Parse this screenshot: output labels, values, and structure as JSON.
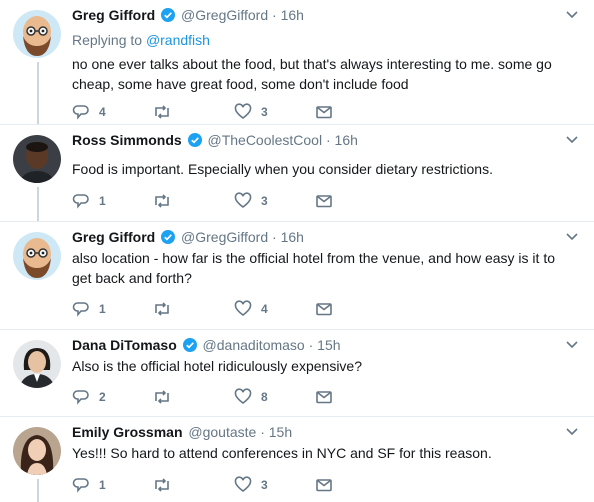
{
  "tweets": [
    {
      "name": "Greg Gifford",
      "handle": "@GregGifford",
      "time": "16h",
      "verified": true,
      "replying_prefix": "Replying to",
      "replying_to": "@randfish",
      "text": "no one ever talks about the food, but that's always interesting to me. some go cheap, some have great food, some don't include food",
      "replies": "4",
      "retweets": "",
      "likes": "3",
      "avatar": "bald-bearded-cartoon"
    },
    {
      "name": "Ross Simmonds",
      "handle": "@TheCoolestCool",
      "time": "16h",
      "verified": true,
      "text": "Food is important. Especially when you consider dietary restrictions.",
      "replies": "1",
      "retweets": "",
      "likes": "3",
      "avatar": "photo-man"
    },
    {
      "name": "Greg Gifford",
      "handle": "@GregGifford",
      "time": "16h",
      "verified": true,
      "text": "also location - how far is the official hotel from the venue, and how easy is it to get back and forth?",
      "replies": "1",
      "retweets": "",
      "likes": "4",
      "avatar": "bald-bearded-cartoon"
    },
    {
      "name": "Dana DiTomaso",
      "handle": "@danaditomaso",
      "time": "15h",
      "verified": true,
      "text": "Also is the official hotel ridiculously expensive?",
      "replies": "2",
      "retweets": "",
      "likes": "8",
      "avatar": "photo-woman-dark-hair"
    },
    {
      "name": "Emily Grossman",
      "handle": "@goutaste",
      "time": "15h",
      "verified": false,
      "text": "Yes!!! So hard to attend conferences in NYC and SF for this reason.",
      "replies": "1",
      "retweets": "",
      "likes": "3",
      "avatar": "photo-woman-long-hair"
    }
  ],
  "colors": {
    "text": "#14171a",
    "muted": "#657786",
    "link": "#1b95e0",
    "verified": "#1da1f2",
    "thread": "#ccd6dd",
    "separator": "#e6ecf0"
  },
  "icons": [
    "reply-icon",
    "retweet-icon",
    "like-icon",
    "direct-message-icon",
    "verified-badge-icon",
    "chevron-down-icon"
  ],
  "separator": "·"
}
